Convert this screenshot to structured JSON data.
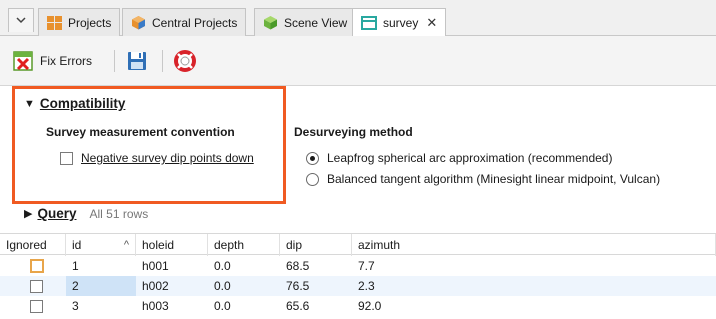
{
  "tabs": [
    {
      "label": "Projects",
      "icon": "projects-grid-icon"
    },
    {
      "label": "Central Projects",
      "icon": "central-projects-icon"
    },
    {
      "label": "Scene View",
      "icon": "scene-view-cube-icon"
    },
    {
      "label": "survey",
      "icon": "table-icon",
      "active": true,
      "close": "✕"
    }
  ],
  "toolbar": {
    "fix_errors_label": "Fix Errors"
  },
  "compatibility": {
    "title": "Compatibility",
    "survey_convention_heading": "Survey measurement convention",
    "negative_dip_label": "Negative survey dip points down",
    "negative_dip_checked": false,
    "desurveying_heading": "Desurveying method",
    "method_options": [
      {
        "label": "Leapfrog spherical arc approximation (recommended)",
        "selected": true
      },
      {
        "label": "Balanced tangent algorithm (Minesight linear midpoint, Vulcan)",
        "selected": false
      }
    ]
  },
  "query": {
    "title": "Query",
    "row_count": "All 51 rows"
  },
  "table": {
    "columns": [
      "Ignored",
      "id",
      "holeid",
      "depth",
      "dip",
      "azimuth"
    ],
    "rows": [
      {
        "ignored": false,
        "id": "1",
        "holeid": "h001",
        "depth": "0.0",
        "dip": "68.5",
        "azimuth": "7.7"
      },
      {
        "ignored": false,
        "id": "2",
        "holeid": "h002",
        "depth": "0.0",
        "dip": "76.5",
        "azimuth": "2.3"
      },
      {
        "ignored": false,
        "id": "3",
        "holeid": "h003",
        "depth": "0.0",
        "dip": "65.6",
        "azimuth": "92.0"
      }
    ]
  },
  "colors": {
    "highlight": "#f05a22",
    "selected_row": "#eef5fd",
    "selected_cell": "#cfe3f7"
  }
}
